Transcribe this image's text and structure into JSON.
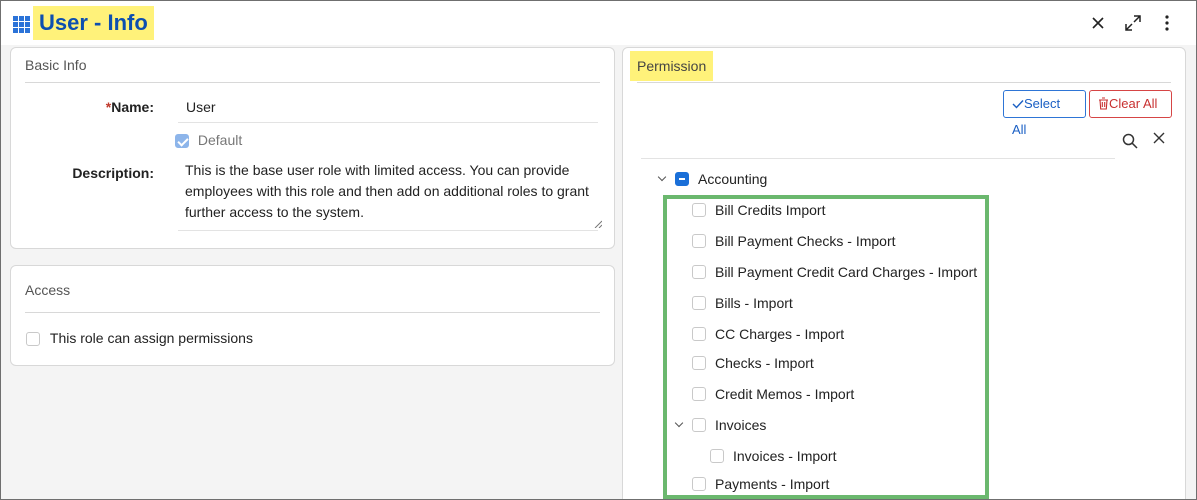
{
  "window": {
    "title": "User - Info",
    "icons": {
      "app": "grid-icon",
      "close": "close-icon",
      "expand": "expand-icon",
      "more": "more-vertical-icon"
    }
  },
  "basic_info": {
    "header": "Basic Info",
    "name_label": "Name:",
    "name_required_mark": "*",
    "name_value": "User",
    "default_label": "Default",
    "default_checked": true,
    "description_label": "Description:",
    "description_value": "This is the base user role with limited access.  You can provide employees with this role and then add on additional roles to grant further access to the system."
  },
  "access": {
    "header": "Access",
    "assign_label": "This role can assign permissions",
    "assign_checked": false
  },
  "permission": {
    "header": "Permission",
    "select_all_label": "Select All",
    "clear_all_label": "Clear All",
    "accent_select": "#2e75d6",
    "accent_clear": "#d64545",
    "highlight_color": "#fff27a",
    "box_color": "#6bb86e",
    "tree": {
      "root_label": "Accounting",
      "root_state": "partial",
      "items": [
        {
          "label": "Bill Credits Import"
        },
        {
          "label": "Bill Payment Checks - Import"
        },
        {
          "label": "Bill Payment Credit Card Charges - Import"
        },
        {
          "label": "Bills - Import"
        },
        {
          "label": "CC Charges - Import"
        },
        {
          "label": "Checks - Import"
        },
        {
          "label": "Credit Memos - Import"
        },
        {
          "label": "Invoices"
        },
        {
          "label": "Invoices - Import"
        },
        {
          "label": "Payments - Import"
        }
      ]
    }
  }
}
